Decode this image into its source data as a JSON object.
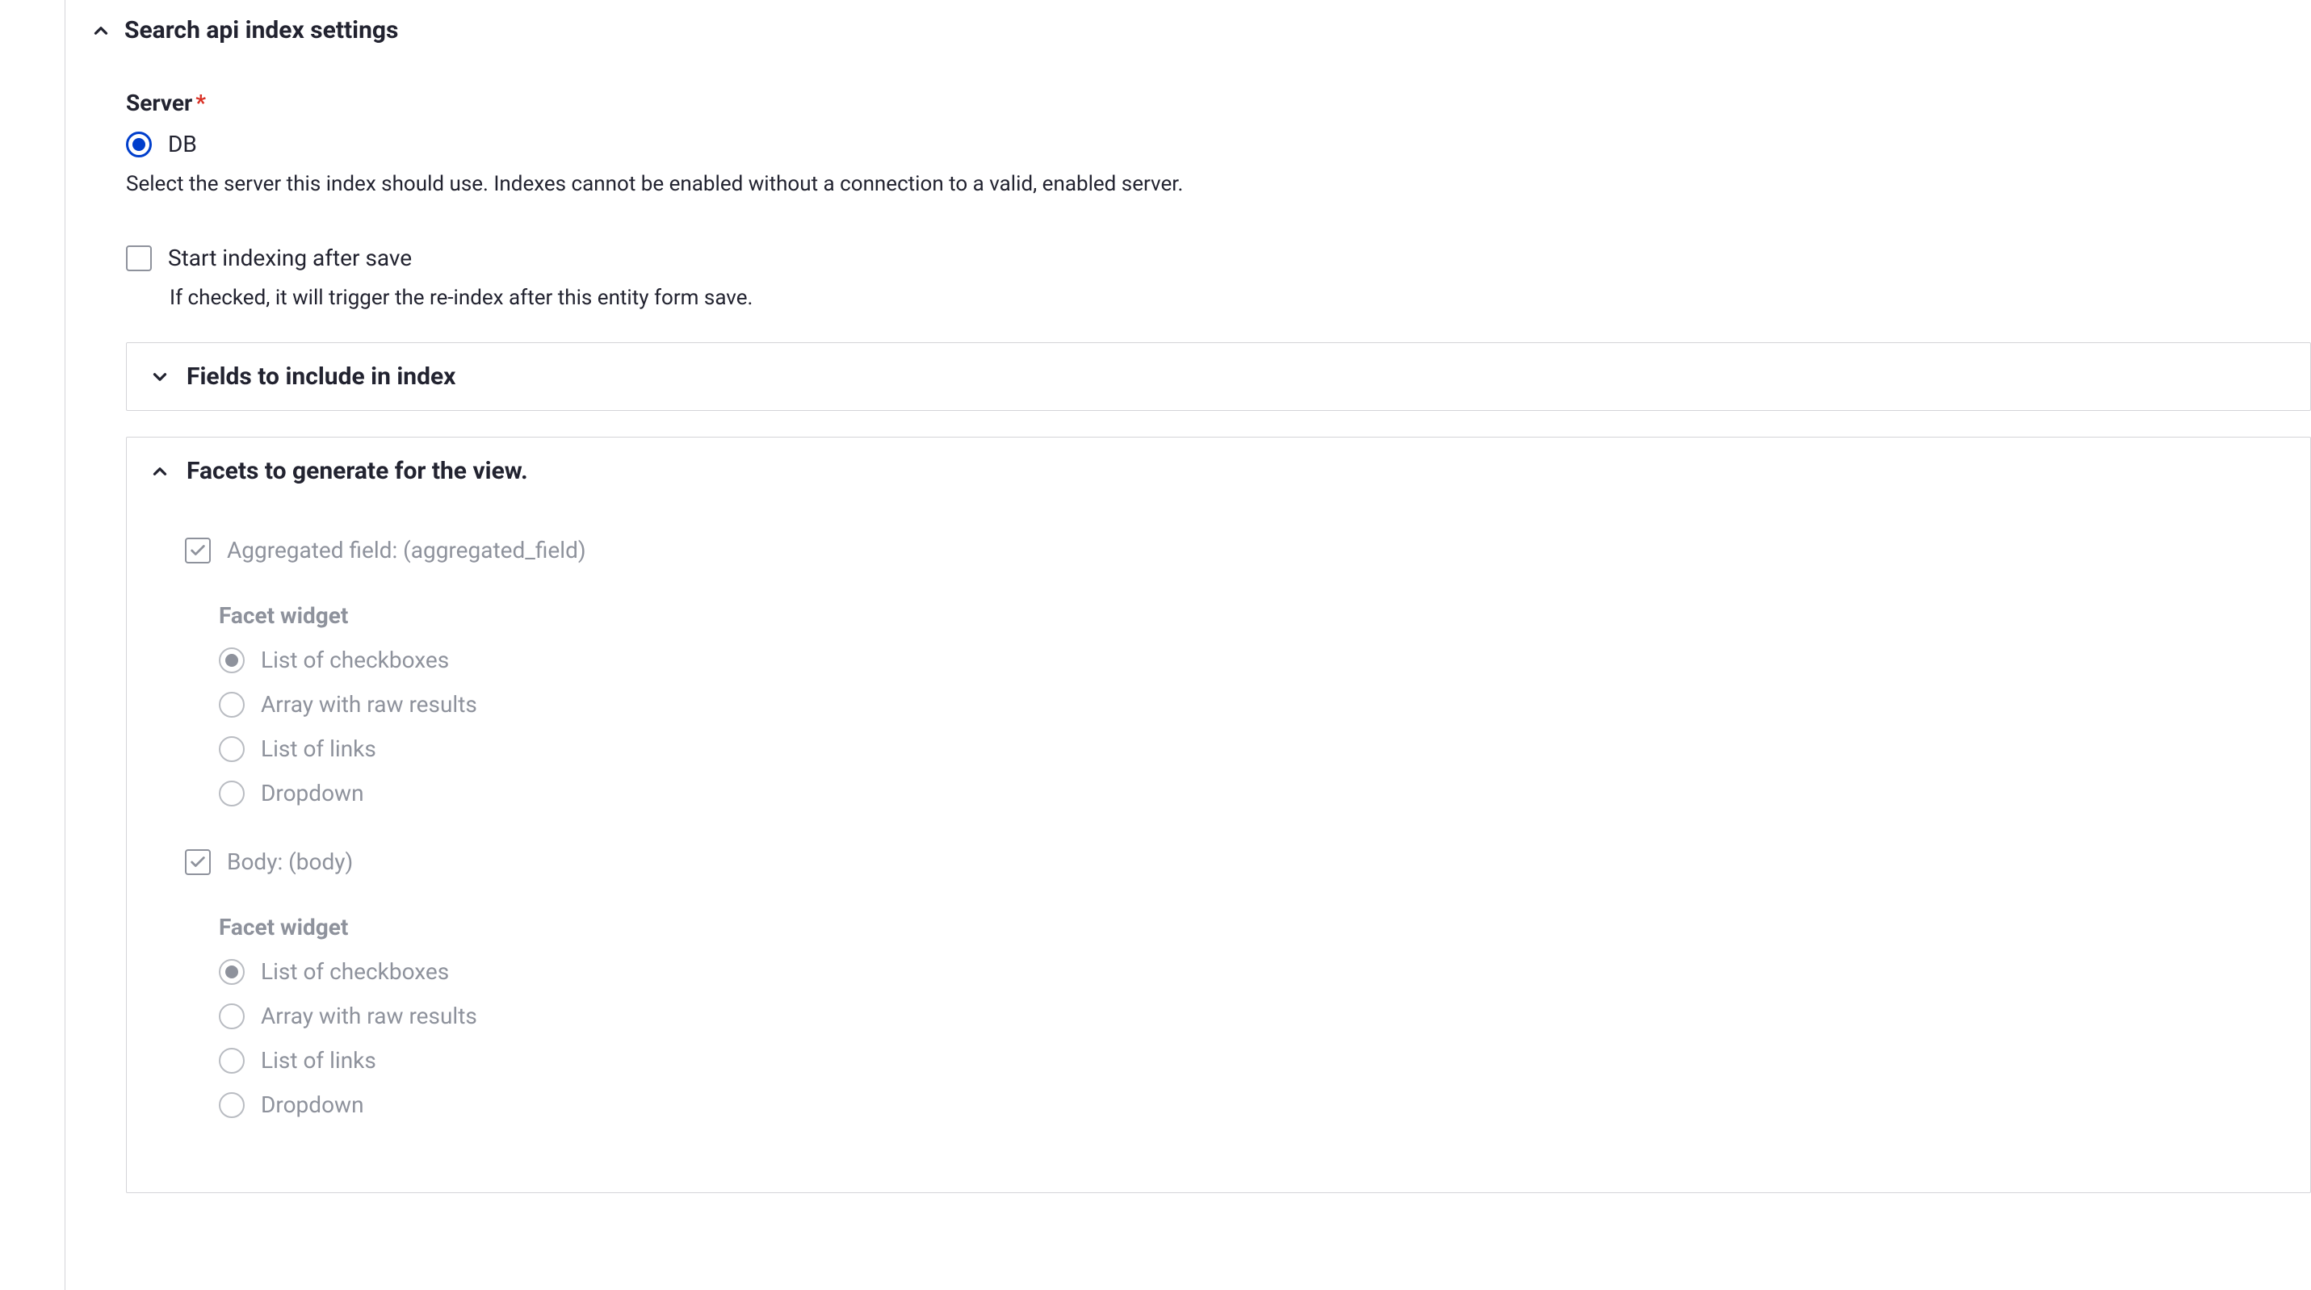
{
  "main": {
    "section_title": "Search api index settings",
    "server": {
      "label": "Server",
      "required_mark": "*",
      "options": [
        {
          "label": "DB",
          "checked": true
        }
      ],
      "description": "Select the server this index should use. Indexes cannot be enabled without a connection to a valid, enabled server."
    },
    "start_indexing": {
      "label": "Start indexing after save",
      "checked": false,
      "description": "If checked, it will trigger the re-index after this entity form save."
    },
    "fields_section": {
      "title": "Fields to include in index",
      "expanded": false
    },
    "facets_section": {
      "title": "Facets to generate for the view.",
      "expanded": true,
      "widget_legend": "Facet widget",
      "widget_options": [
        "List of checkboxes",
        "Array with raw results",
        "List of links",
        "Dropdown"
      ],
      "items": [
        {
          "label": "Aggregated field: (aggregated_field)",
          "checked": true,
          "selected_widget": 0
        },
        {
          "label": "Body: (body)",
          "checked": true,
          "selected_widget": 0
        }
      ]
    }
  }
}
